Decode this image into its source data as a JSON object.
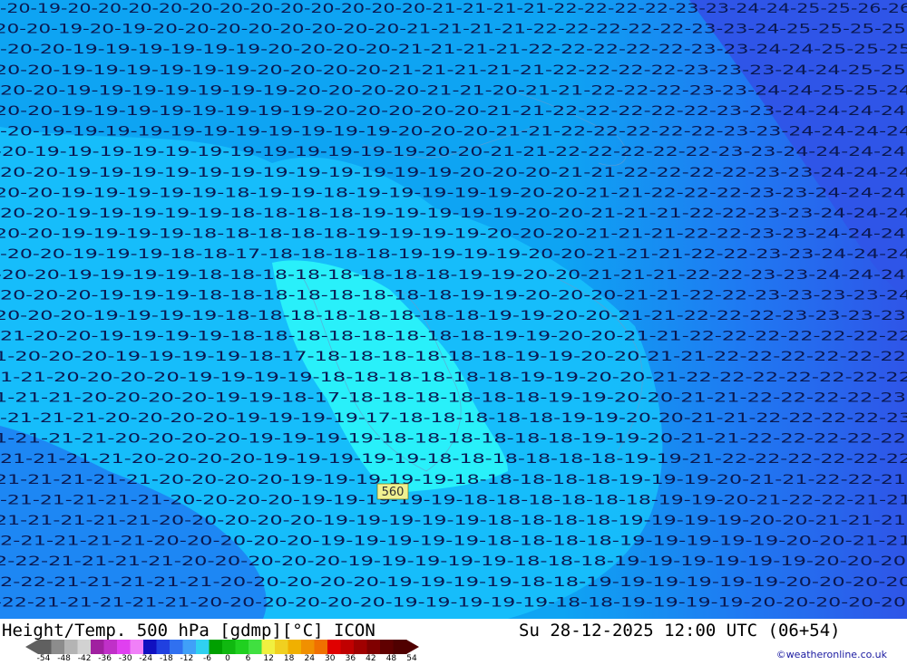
{
  "title": "Height/Temp. 500 hPa [gdmp][°C] ICON",
  "valid_time": "Su 28-12-2025 12:00 UTC (06+54)",
  "credit": "©weatheronline.co.uk",
  "contour_label": "560",
  "legend": {
    "ticks": [
      "-54",
      "-48",
      "-42",
      "-36",
      "-30",
      "-24",
      "-18",
      "-12",
      "-6",
      "0",
      "6",
      "12",
      "18",
      "24",
      "30",
      "36",
      "42",
      "48",
      "54"
    ],
    "colors": [
      "#606060",
      "#8c8c8c",
      "#b4b4b4",
      "#d2d2d2",
      "#a020a0",
      "#c030c8",
      "#e040f0",
      "#f080f8",
      "#1010c0",
      "#2040e0",
      "#3070f0",
      "#40a0f8",
      "#30d0f0",
      "#00a000",
      "#10b810",
      "#20d020",
      "#40e040",
      "#f0f040",
      "#f0d020",
      "#f0b000",
      "#f09000",
      "#f07000",
      "#e00000",
      "#c00000",
      "#a00000",
      "#800000",
      "#600000",
      "#500000"
    ],
    "sample_field_colors": {
      "cold_core": "#29f0fa",
      "mid": "#17c2fc",
      "base": "#0ea4f3",
      "warm": "#1f79f2",
      "warmer": "#2f55e8"
    }
  },
  "temp_labels": [
    {
      "row": 0,
      "text": "-20-19-20-20-20-20-20-20-20-20-20-20-20-20-21-21-21-21-22-22-22-22-23-23-24-24-25-25-26-26"
    },
    {
      "row": 1,
      "text": "20-20-19-20-19-20-20-20-20-20-20-20-20-21-21-21-21-22-22-22-22-22-23-23-24-25-25-25-25"
    },
    {
      "row": 2,
      "text": "-20-20-19-19-19-19-19-19-20-20-20-20-21-21-21-21-22-22-22-22-22-23-23-24-24-25-25-25"
    },
    {
      "row": 3,
      "text": "20-20-19-19-19-19-19-19-20-20-20-20-21-21-21-21-21-22-22-22-22-23-23-23-24-24-25-25"
    },
    {
      "row": 4,
      "text": "20-20-19-19-19-19-19-19-19-20-20-20-20-21-21-20-21-21-22-22-22-23-23-24-24-25-25-24"
    },
    {
      "row": 5,
      "text": "20-20-19-19-19-19-19-19-19-19-20-20-20-20-20-21-21-22-22-22-22-22-23-23-24-24-24-24"
    },
    {
      "row": 6,
      "text": "-20-19-19-19-19-19-19-19-19-19-19-19-20-20-20-21-21-22-22-22-22-22-23-23-24-24-24-24"
    },
    {
      "row": 7,
      "text": "-20-19-19-19-19-19-19-19-19-19-19-19-19-20-20-21-21-22-22-22-22-22-23-23-24-24-24-24"
    },
    {
      "row": 8,
      "text": "20-20-19-19-19-19-19-19-19-19-19-19-19-19-20-20-20-21-21-22-22-22-22-23-23-24-24-24"
    },
    {
      "row": 9,
      "text": "20-20-19-19-19-19-19-18-19-19-18-19-19-19-19-19-20-20-21-21-22-22-22-23-23-24-24-24"
    },
    {
      "row": 10,
      "text": "20-20-19-19-19-19-19-18-18-18-18-19-19-19-19-19-20-20-21-21-21-22-22-23-23-24-24-24"
    },
    {
      "row": 11,
      "text": "20-20-19-19-19-19-18-18-18-18-18-19-19-19-19-20-20-20-21-21-21-22-22-23-23-24-24-24"
    },
    {
      "row": 12,
      "text": "-20-20-19-19-19-18-18-17-18-18-18-18-19-19-19-19-20-20-21-21-21-22-22-23-23-24-24-24"
    },
    {
      "row": 13,
      "text": "-20-20-19-19-19-19-18-18-18-18-18-18-18-18-19-19-20-20-21-21-21-22-22-23-23-24-24-24"
    },
    {
      "row": 14,
      "text": "20-20-20-19-19-19-18-18-18-18-18-18-18-18-19-19-20-20-20-21-21-22-22-23-23-23-23-24"
    },
    {
      "row": 15,
      "text": "20-20-20-19-19-19-19-18-18-18-18-18-18-18-18-19-19-20-20-21-21-22-22-22-23-23-23-23"
    },
    {
      "row": 16,
      "text": "21-20-20-19-19-19-19-18-18-18-18-18-18-18-18-19-19-20-20-21-21-22-22-22-22-22-22-22"
    },
    {
      "row": 17,
      "text": "1-20-20-20-19-19-19-19-18-17-18-18-18-18-18-18-19-19-20-20-21-21-22-22-22-22-22-22"
    },
    {
      "row": 18,
      "text": "1-21-20-20-20-20-19-19-19-19-18-18-18-18-18-18-19-19-20-20-21-22-22-22-22-22-22-22"
    },
    {
      "row": 19,
      "text": "1-21-21-20-20-20-20-19-19-18-17-18-18-18-18-18-18-19-19-20-20-21-21-22-22-22-22-23"
    },
    {
      "row": 20,
      "text": "-21-21-21-20-20-20-20-19-19-19-19-17-18-18-18-18-18-19-19-20-20-21-21-22-22-22-22-23"
    },
    {
      "row": 21,
      "text": "1-21-21-21-20-20-20-20-19-19-19-19-18-18-18-18-18-18-19-19-20-21-21-22-22-22-22-22"
    },
    {
      "row": 22,
      "text": "21-21-21-21-20-20-20-20-19-19-19-19-19-18-18-18-18-18-18-19-19-21-22-22-22-22-22-22"
    },
    {
      "row": 23,
      "text": "21-21-21-21-21-20-20-20-20-19-19-19-19-19-18-18-18-18-18-19-19-19-20-21-21-22-22-21"
    },
    {
      "row": 24,
      "text": "-21-21-21-21-21-20-20-20-20-19-19-19-19-19-18-18-18-18-18-18-19-19-20-21-22-22-21-21"
    },
    {
      "row": 25,
      "text": "21-21-21-21-21-20-20-20-20-20-19-19-19-19-19-18-18-18-18-19-19-19-19-20-20-21-21-21"
    },
    {
      "row": 26,
      "text": "2-21-21-21-21-20-20-20-20-20-19-19-19-19-19-18-18-18-18-19-19-19-19-19-20-20-21-21"
    },
    {
      "row": 27,
      "text": "2-22-21-21-21-21-20-20-20-20-20-19-19-19-19-19-18-18-18-19-19-19-19-19-19-20-20-20"
    },
    {
      "row": 28,
      "text": "2-22-21-21-21-21-21-20-20-20-20-20-19-19-19-19-18-18-19-19-19-19-19-19-20-20-20-20"
    },
    {
      "row": 29,
      "text": "-22-21-21-21-21-21-20-20-20-20-20-20-19-19-19-19-19-18-18-19-19-19-19-20-20-20-20-20"
    }
  ]
}
